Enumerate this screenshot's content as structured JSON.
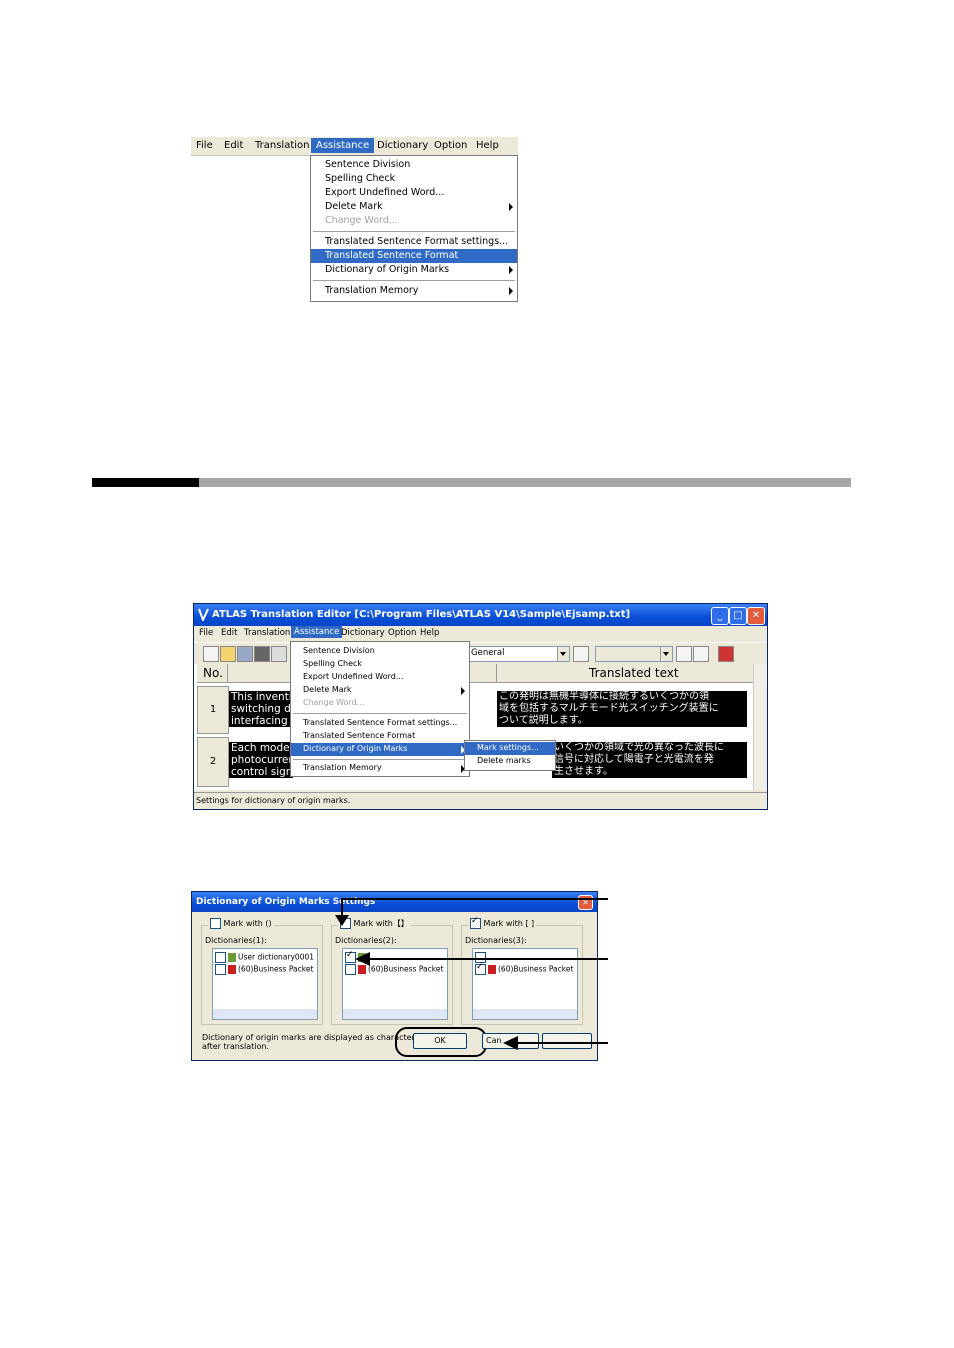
{
  "menu1": {
    "bar": [
      "File",
      "Edit",
      "Translation",
      "Assistance",
      "Dictionary",
      "Option",
      "Help"
    ],
    "items": [
      {
        "label": "Sentence Division"
      },
      {
        "label": "Spelling Check"
      },
      {
        "label": "Export Undefined Word..."
      },
      {
        "label": "Delete Mark",
        "submenu": true
      },
      {
        "label": "Change Word...",
        "disabled": true
      },
      {
        "label": "Translated Sentence Format settings..."
      },
      {
        "label": "Translated Sentence Format",
        "highlighted": true
      },
      {
        "label": "Dictionary of Origin Marks",
        "submenu": true
      },
      {
        "label": "Translation Memory",
        "submenu": true
      }
    ]
  },
  "editor": {
    "title": "ATLAS Translation Editor  [C:\\Program Files\\ATLAS V14\\Sample\\Ejsamp.txt]",
    "menubar": [
      "File",
      "Edit",
      "Translation",
      "Assistance",
      "Dictionary",
      "Option",
      "Help"
    ],
    "field_combo": "General",
    "col_no": "No.",
    "col_translated": "Translated text",
    "rows": [
      {
        "num": "1",
        "source": [
          "This inventi",
          "switching de",
          "interfacing w"
        ],
        "translated": [
          "この発明は無機半導体に接続するいくつかの領",
          "域を包括するマルチモード光スイッチング装置に",
          "ついて説明します。"
        ]
      },
      {
        "num": "2",
        "source": [
          "Each mode",
          "photocurren",
          "control sign"
        ],
        "translated": [
          "いくつかの領域で光の異なった波長に",
          "信号に対応して陽電子と光電流を発",
          "生させます。"
        ]
      }
    ],
    "menu": [
      {
        "label": "Sentence Division"
      },
      {
        "label": "Spelling Check"
      },
      {
        "label": "Export Undefined Word..."
      },
      {
        "label": "Delete Mark",
        "submenu": true
      },
      {
        "label": "Change Word...",
        "disabled": true
      },
      {
        "label": "Translated Sentence Format settings..."
      },
      {
        "label": "Translated Sentence Format"
      },
      {
        "label": "Dictionary of Origin Marks",
        "submenu": true,
        "highlighted": true
      },
      {
        "label": "Translation Memory",
        "submenu": true
      }
    ],
    "submenu": [
      {
        "label": "Mark settings...",
        "highlighted": true
      },
      {
        "label": "Delete marks"
      }
    ],
    "status": "Settings for dictionary of origin marks."
  },
  "dialog": {
    "title": "Dictionary of Origin Marks Settings",
    "groups": [
      {
        "caption": "Mark with ()",
        "checked": false,
        "dict_label": "Dictionaries(1):",
        "items": [
          {
            "label": "User dictionary0001",
            "checked": false
          },
          {
            "label": "(60)Business Packet",
            "checked": false
          }
        ]
      },
      {
        "caption": "Mark with【】",
        "checked": true,
        "dict_label": "Dictionaries(2):",
        "items": [
          {
            "label": "",
            "checked": true
          },
          {
            "label": "(60)Business Packet",
            "checked": false
          }
        ]
      },
      {
        "caption": "Mark with [ ]",
        "checked": true,
        "dict_label": "Dictionaries(3):",
        "items": [
          {
            "label": "",
            "checked": false
          },
          {
            "label": "(60)Business Packet",
            "checked": true
          }
        ]
      }
    ],
    "note": "Dictionary of origin marks are displayed as character\nafter translation.",
    "ok_label": "OK",
    "cancel_label": "Can"
  },
  "colors": {
    "highlight": "#316ac5",
    "window_bg": "#ece9d8",
    "titlebar": "#0a4ed6"
  }
}
